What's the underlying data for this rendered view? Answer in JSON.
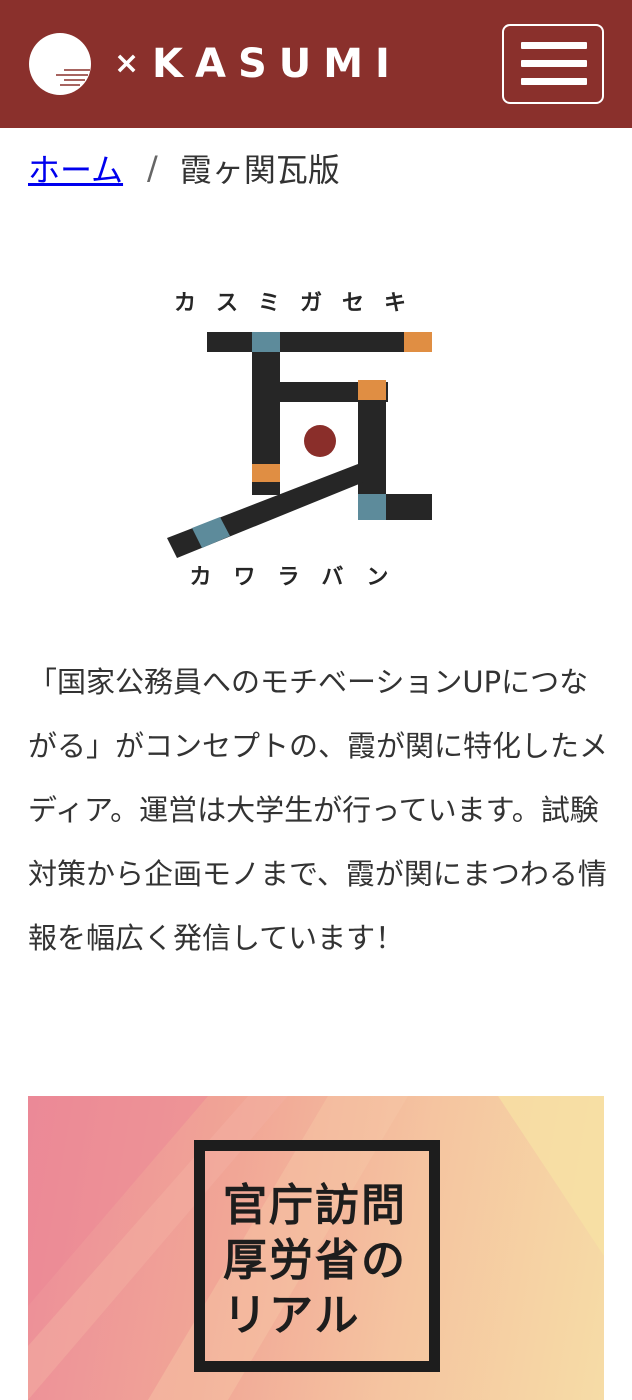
{
  "header": {
    "brand_x": "×",
    "brand_name": "KASUMI",
    "background_color": "#8a302c"
  },
  "breadcrumb": {
    "home": "ホーム",
    "separator": "/",
    "current": "霞ヶ関瓦版"
  },
  "hero_logo": {
    "top_text": "カスミガセキ",
    "bottom_text": "カワラバン",
    "colors": {
      "dark": "#262626",
      "teal": "#5d8b9b",
      "orange": "#e08e43",
      "red": "#8a2e2a"
    }
  },
  "description": "「国家公務員へのモチベーションUPにつながる」がコンセプトの、霞が関に特化したメディア。運営は大学生が行っています。試験対策から企画モノまで、霞が関にまつわる情報を幅広く発信しています！",
  "banner": {
    "lines": [
      "官庁訪問",
      "厚労省の",
      "リアル"
    ]
  }
}
